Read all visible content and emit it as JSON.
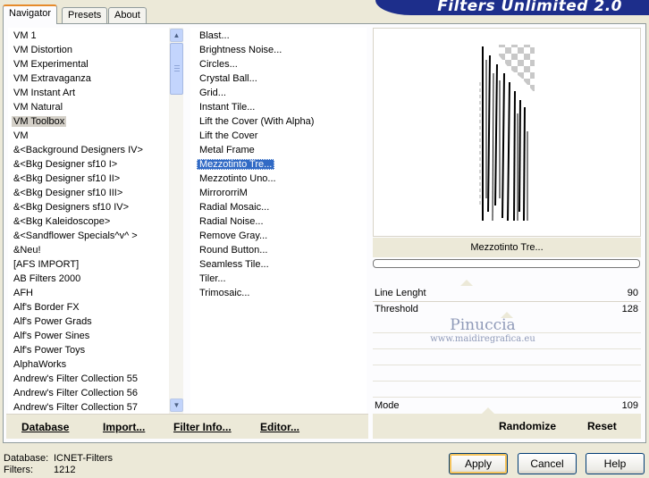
{
  "tabs": [
    {
      "label": "Navigator",
      "active": true
    },
    {
      "label": "Presets",
      "active": false
    },
    {
      "label": "About",
      "active": false
    }
  ],
  "app_title": "Filters Unlimited 2.0",
  "categories": [
    "VM 1",
    "VM Distortion",
    "VM Experimental",
    "VM Extravaganza",
    "VM Instant Art",
    "VM Natural",
    "VM Toolbox",
    "VM",
    "&<Background Designers IV>",
    "&<Bkg Designer sf10 I>",
    "&<Bkg Designer sf10 II>",
    "&<Bkg Designer sf10 III>",
    "&<Bkg Designers sf10 IV>",
    "&<Bkg Kaleidoscope>",
    "&<Sandflower Specials^v^ >",
    "&Neu!",
    "[AFS IMPORT]",
    "AB Filters 2000",
    "AFH",
    "Alf's Border FX",
    "Alf's Power Grads",
    "Alf's Power Sines",
    "Alf's Power Toys",
    "AlphaWorks",
    "Andrew's Filter Collection 55",
    "Andrew's Filter Collection 56",
    "Andrew's Filter Collection 57"
  ],
  "selected_category": "VM Toolbox",
  "filters": [
    "Blast...",
    "Brightness Noise...",
    "Circles...",
    "Crystal Ball...",
    "Grid...",
    "Instant Tile...",
    "Lift the Cover (With Alpha)",
    "Lift the Cover",
    "Metal Frame",
    "Mezzotinto Tre...",
    "Mezzotinto Uno...",
    "MirrororriM",
    "Radial Mosaic...",
    "Radial Noise...",
    "Remove Gray...",
    "Round Button...",
    "Seamless Tile...",
    "Tiler...",
    "Trimosaic..."
  ],
  "selected_filter": "Mezzotinto Tre...",
  "toolbar": {
    "database_label": "Database",
    "import_label": "Import...",
    "filter_info_label": "Filter Info...",
    "editor_label": "Editor..."
  },
  "preview_caption": "Mezzotinto Tre...",
  "controls": [
    {
      "label": "Line Lenght",
      "value": "90",
      "level": 0.35
    },
    {
      "label": "Threshold",
      "value": "128",
      "level": 0.5
    }
  ],
  "mode": {
    "label": "Mode",
    "value": "109",
    "level": 0.43
  },
  "watermark": {
    "line1": "Pinuccia",
    "line2": "www.maidiregrafica.eu"
  },
  "actions": {
    "randomize_label": "Randomize",
    "reset_label": "Reset"
  },
  "status": {
    "database_key": "Database:",
    "database_value": "ICNET-Filters",
    "filters_key": "Filters:",
    "filters_value": "1212"
  },
  "buttons": {
    "apply": "Apply",
    "cancel": "Cancel",
    "help": "Help"
  },
  "colors": {
    "selection": "#316ac5",
    "banner": "#1d2e8b",
    "dialog_bg": "#ece9d8"
  }
}
